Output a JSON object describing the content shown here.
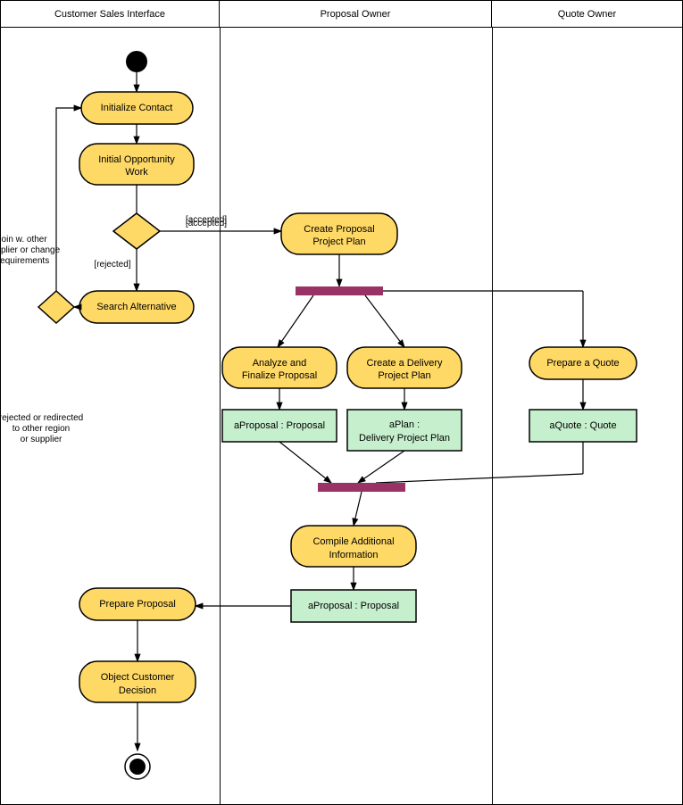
{
  "header": {
    "col1": "Customer Sales Interface",
    "col2": "Proposal Owner",
    "col3": "Quote Owner"
  },
  "nodes": {
    "initialize_contact": "Initialize Contact",
    "initial_opportunity": "Initial Opportunity\nWork",
    "search_alternative": "Search Alternative",
    "create_proposal_plan": "Create Proposal\nProject Plan",
    "analyze_finalize": "Analyze and\nFinalize Proposal",
    "create_delivery_plan": "Create a Delivery\nProject Plan",
    "prepare_quote": "Prepare a Quote",
    "aproposal1": "aProposal : Proposal",
    "aplan": "aPlan :\nDelivery Project Plan",
    "aquote": "aQuote : Quote",
    "compile_info": "Compile Additional\nInformation",
    "aproposal2": "aProposal : Proposal",
    "prepare_proposal": "Prepare Proposal",
    "object_customer": "Object Customer\nDecision"
  },
  "labels": {
    "accepted": "[accepted]",
    "rejected": "[rejected]",
    "join_note": "join w. other\nsupplier or change\nrequirements",
    "rejected_note": "rejected or redirected\nto other region\nor supplier"
  }
}
